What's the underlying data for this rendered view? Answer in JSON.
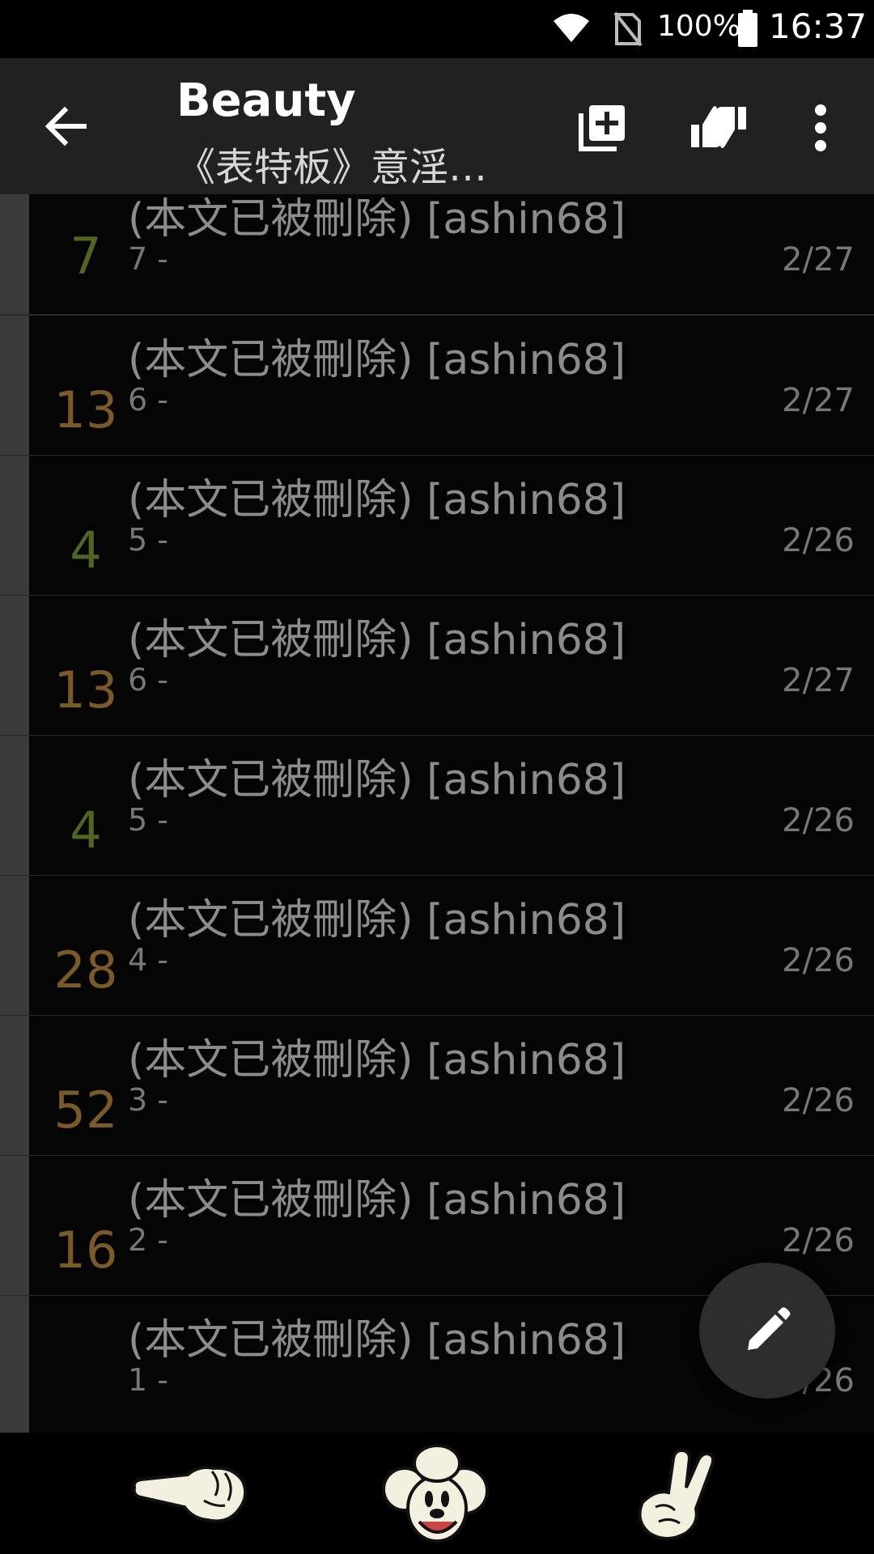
{
  "status_bar": {
    "battery": "100%",
    "time": "16:37"
  },
  "toolbar": {
    "title": "Beauty",
    "subtitle": "《表特板》意淫文..."
  },
  "rows": [
    {
      "score": "7",
      "score_color": "green",
      "title": "(本文已被刪除) [ashin68]",
      "meta": "7 -",
      "date": "2/27"
    },
    {
      "score": "13",
      "score_color": "brown",
      "title": "(本文已被刪除) [ashin68]",
      "meta": "6 -",
      "date": "2/27"
    },
    {
      "score": "4",
      "score_color": "green",
      "title": "(本文已被刪除) [ashin68]",
      "meta": "5 -",
      "date": "2/26"
    },
    {
      "score": "13",
      "score_color": "brown",
      "title": "(本文已被刪除) [ashin68]",
      "meta": "6 -",
      "date": "2/27"
    },
    {
      "score": "4",
      "score_color": "green",
      "title": "(本文已被刪除) [ashin68]",
      "meta": "5 -",
      "date": "2/26"
    },
    {
      "score": "28",
      "score_color": "brown",
      "title": "(本文已被刪除) [ashin68]",
      "meta": "4 -",
      "date": "2/26"
    },
    {
      "score": "52",
      "score_color": "brown",
      "title": "(本文已被刪除) [ashin68]",
      "meta": "3 -",
      "date": "2/26"
    },
    {
      "score": "16",
      "score_color": "brown",
      "title": "(本文已被刪除) [ashin68]",
      "meta": "2 -",
      "date": "2/26"
    },
    {
      "score": "",
      "score_color": "brown",
      "title": "(本文已被刪除) [ashin68]",
      "meta": "1 -",
      "date": "2/26"
    }
  ],
  "colors": {
    "score_green": "#51661f",
    "score_brown": "#7a5a26",
    "toolbar_bg": "#212121"
  },
  "icons": [
    "back-arrow-icon",
    "add-to-list-icon",
    "vote-icon",
    "more-vert-icon",
    "pencil-icon",
    "pointing-hand-icon",
    "mickey-icon",
    "peace-hand-icon"
  ]
}
